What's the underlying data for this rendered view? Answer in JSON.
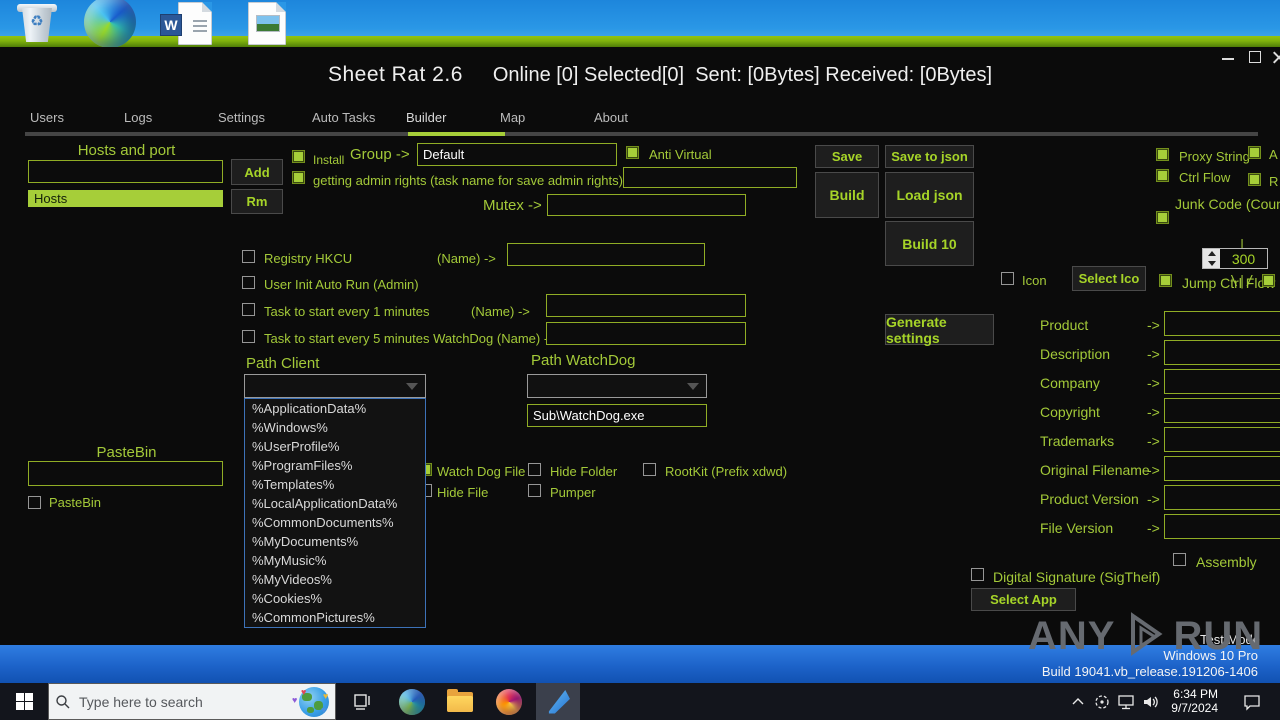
{
  "desktop": {
    "icons": [
      "recycle-bin",
      "microsoft-edge",
      "word-document",
      "image-document"
    ],
    "word_letter": "W",
    "recycle_symbol": "♻"
  },
  "window": {
    "title": "Sheet Rat 2.6",
    "status": "Online [0] Selected[0]  Sent: [0Bytes] Received: [0Bytes]"
  },
  "tabs": [
    {
      "label": "Users",
      "active": false
    },
    {
      "label": "Logs",
      "active": false
    },
    {
      "label": "Settings",
      "active": false
    },
    {
      "label": "Auto Tasks",
      "active": false
    },
    {
      "label": "Builder",
      "active": true
    },
    {
      "label": "Map",
      "active": false
    },
    {
      "label": "About",
      "active": false
    }
  ],
  "hosts": {
    "title": "Hosts and port",
    "input_value": "",
    "add": "Add",
    "header": "Hosts",
    "rm": "Rm"
  },
  "pastebin": {
    "title": "PasteBin",
    "input_value": "",
    "checkbox_label": "PasteBin"
  },
  "builder": {
    "install": "Install",
    "group_label": "Group ->",
    "group_value": "Default",
    "anti_virtual": "Anti Virtual",
    "admin_rights": "getting admin rights (task name for save admin rights) ->",
    "mutex_label": "Mutex ->",
    "registry_hkcu": "Registry HKCU",
    "registry_name_label": "(Name) ->",
    "user_init": "User Init Auto Run (Admin)",
    "task_1min": "Task to start every 1 minutes",
    "task_1min_name_label": "(Name) ->",
    "task_5min": "Task to start every 5 minutes WatchDog (Name) ->",
    "path_client": "Path Client",
    "path_watchdog": "Path WatchDog",
    "watchdog_exe": "Sub\\WatchDog.exe",
    "path_options": [
      "%ApplicationData%",
      "%Windows%",
      "%UserProfile%",
      "%ProgramFiles%",
      "%Templates%",
      "%LocalApplicationData%",
      "%CommonDocuments%",
      "%MyDocuments%",
      "%MyMusic%",
      "%MyVideos%",
      "%Cookies%",
      "%CommonPictures%"
    ],
    "watch_dog_file": "Watch Dog File",
    "hide_folder": "Hide Folder",
    "rootkit": "RootKit (Prefix xdwd)",
    "hide_file": "Hide File",
    "pumper": "Pumper"
  },
  "actions": {
    "save": "Save",
    "save_to_json": "Save to json",
    "build": "Build",
    "load_json": "Load json",
    "build_10": "Build 10",
    "generate_settings": "Generate settings",
    "select_ico": "Select Ico",
    "select_app": "Select App"
  },
  "obfuscation": {
    "proxy_string": "Proxy String",
    "label_a_cut": "A",
    "ctrl_flow": "Ctrl Flow",
    "label_r_cut": "R",
    "junk_code": "Junk Code (Count J",
    "junk_arrow_top": "|",
    "junk_arrow_bottom": "\\|/",
    "junk_count": "300",
    "icon_label": "Icon",
    "jump_ctrl_flow": "Jump Ctrl Flow",
    "assembly": "Assembly",
    "digital_signature": "Digital Signature (SigTheif)"
  },
  "version_info": {
    "fields": [
      {
        "label": "Product",
        "arrow": "->",
        "value": ""
      },
      {
        "label": "Description",
        "arrow": "->",
        "value": ""
      },
      {
        "label": "Company",
        "arrow": "->",
        "value": ""
      },
      {
        "label": "Copyright",
        "arrow": "->",
        "value": ""
      },
      {
        "label": "Trademarks",
        "arrow": "->",
        "value": ""
      },
      {
        "label": "Original Filename",
        "arrow": "->",
        "value": ""
      },
      {
        "label": "Product Version",
        "arrow": "->",
        "value": ""
      },
      {
        "label": "File Version",
        "arrow": "->",
        "value": ""
      }
    ]
  },
  "sandbox": {
    "watermark_left": "ANY",
    "watermark_right": "RUN",
    "test_mode": "Test Mode",
    "os": "Windows 10 Pro",
    "build": "Build 19041.vb_release.191206-1406"
  },
  "taskbar": {
    "search_placeholder": "Type here to search",
    "time": "6:34 PM",
    "date": "9/7/2024"
  },
  "colors": {
    "accent_green": "#a6ce39",
    "label_green": "#a3c939",
    "dropdown_border_blue": "#3d72b8",
    "sandbox_bar_blue": "#1d63c9",
    "window_bg": "#0b0b0b"
  }
}
